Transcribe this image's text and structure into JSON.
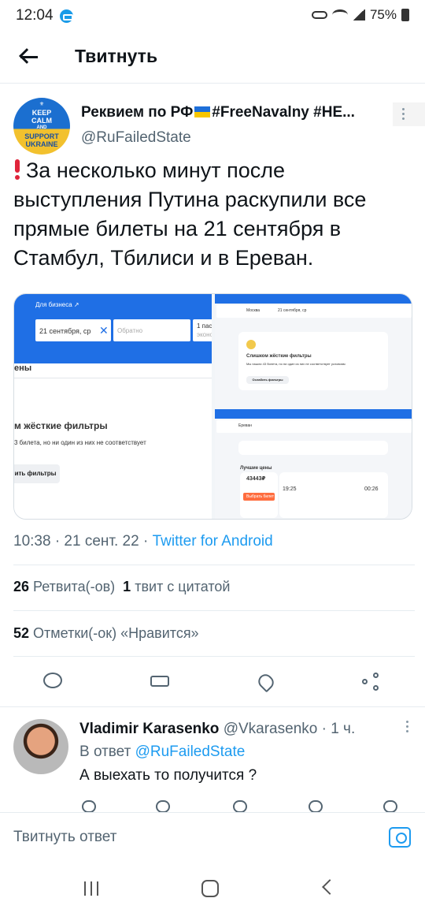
{
  "status_bar": {
    "time": "12:04",
    "battery": "75%"
  },
  "header": {
    "title": "Твитнуть"
  },
  "tweet": {
    "avatar_lines": [
      "KEEP",
      "CALM",
      "AND",
      "SUPPORT",
      "UKRAINE"
    ],
    "author_name": "Реквием по РФ",
    "author_name_suffix": "#FreeNavalny #HE...",
    "author_handle": "@RuFailedState",
    "text": "За несколько минут после выступления Путина раскупили все прямые билеты на 21 сентября в Стамбул, Тбилиси и в Ереван.",
    "timestamp": "10:38 · 21 сент. 22 · ",
    "source": "Twitter for Android",
    "retweets_count": "26",
    "retweets_label": "Ретвита(-ов)",
    "quotes_count": "1",
    "quotes_label": "твит с цитатой",
    "likes_count": "52",
    "likes_label": "Отметки(-ок) «Нравится»"
  },
  "media": {
    "left": {
      "business": "Для бизнеса ↗",
      "date_field": "21 сентября, ср",
      "return_field": "Обратно",
      "pass_label": "1 пас",
      "pass_sub": "эконо",
      "section": "ены",
      "heading": "м жёсткие фильтры",
      "sub": "3 билета, но ни один из них не соответствует",
      "button": "ить фильтры"
    },
    "right": {
      "top_heading": "Слишком жёсткие фильтры",
      "top_sub": "Мы нашли 43 билета, но ни один из них не соответствует условиям",
      "top_button": "Ослабить фильтры",
      "top_from": "Москва",
      "top_to": "21 сентября, ср",
      "bottom_to": "Ереван",
      "best_prices": "Лучшие цены",
      "price": "43443₽",
      "buy": "Выбрать билет",
      "dep_time": "19:25",
      "arr_time": "00:26"
    }
  },
  "reply": {
    "name": "Vladimir Karasenko",
    "handle_time": "@Vkarasenko · 1 ч.",
    "in_reply_prefix": "В ответ ",
    "in_reply_to": "@RuFailedState",
    "text": "А выехать то получится ?"
  },
  "compose": {
    "placeholder": "Твитнуть ответ"
  },
  "colors": {
    "link": "#1d9bf0",
    "secondary": "#536471",
    "media_blue": "#1f6fe5"
  }
}
